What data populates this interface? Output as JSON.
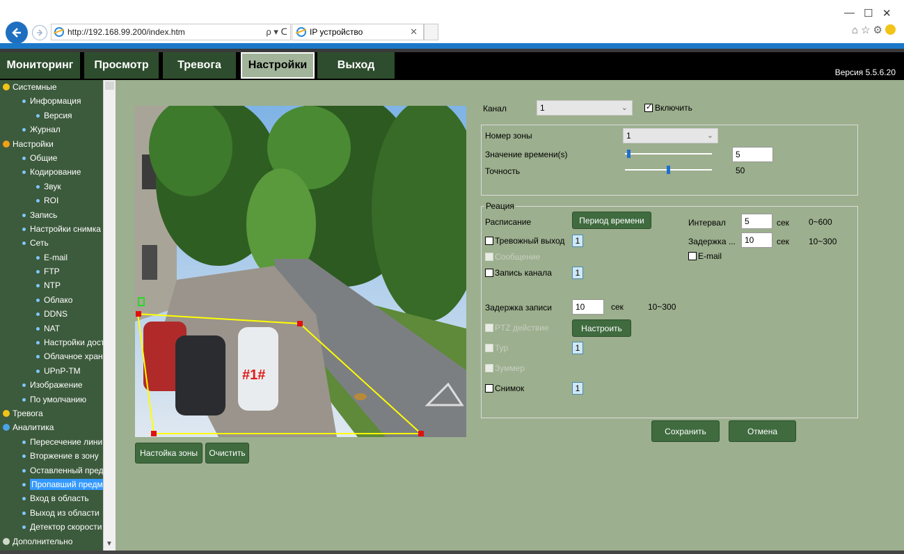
{
  "browser": {
    "url": "http://192.168.99.200/index.htm",
    "url_tools": "ρ ▾ ᑕ",
    "tab_title": "IP устройство"
  },
  "nav": {
    "tabs": [
      {
        "label": "Мониторинг"
      },
      {
        "label": "Просмотр"
      },
      {
        "label": "Тревога"
      },
      {
        "label": "Настройки"
      },
      {
        "label": "Выход"
      }
    ],
    "version": "Версия 5.5.6.20"
  },
  "sidebar": {
    "items": [
      {
        "label": "Системные",
        "level": 0,
        "icon": "info-icon"
      },
      {
        "label": "Информация",
        "level": 1
      },
      {
        "label": "Версия",
        "level": 2
      },
      {
        "label": "Журнал",
        "level": 1
      },
      {
        "label": "Настройки",
        "level": 0,
        "icon": "gear-icon"
      },
      {
        "label": "Общие",
        "level": 1
      },
      {
        "label": "Кодирование",
        "level": 1
      },
      {
        "label": "Звук",
        "level": 2
      },
      {
        "label": "ROI",
        "level": 2
      },
      {
        "label": "Запись",
        "level": 1
      },
      {
        "label": "Настройки снимка",
        "level": 1
      },
      {
        "label": "Сеть",
        "level": 1
      },
      {
        "label": "E-mail",
        "level": 2
      },
      {
        "label": "FTP",
        "level": 2
      },
      {
        "label": "NTP",
        "level": 2
      },
      {
        "label": "Облако",
        "level": 2
      },
      {
        "label": "DDNS",
        "level": 2
      },
      {
        "label": "NAT",
        "level": 2
      },
      {
        "label": "Настройки доступа",
        "level": 2
      },
      {
        "label": "Облачное хранилище",
        "level": 2
      },
      {
        "label": "UPnP-TM",
        "level": 2
      },
      {
        "label": "Изображение",
        "level": 1
      },
      {
        "label": "По умолчанию",
        "level": 1
      },
      {
        "label": "Тревога",
        "level": 0,
        "icon": "alarm-icon"
      },
      {
        "label": "Аналитика",
        "level": 0,
        "icon": "analytics-icon"
      },
      {
        "label": "Пересечение линии",
        "level": 1
      },
      {
        "label": "Вторжение в зону",
        "level": 1
      },
      {
        "label": "Оставленный предмет",
        "level": 1
      },
      {
        "label": "Пропавший предмет",
        "level": 1,
        "selected": true
      },
      {
        "label": "Вход в область",
        "level": 1
      },
      {
        "label": "Выход из области",
        "level": 1
      },
      {
        "label": "Детектор скорости",
        "level": 1
      },
      {
        "label": "Дополнительно",
        "level": 0,
        "icon": "tools-icon"
      }
    ]
  },
  "video": {
    "zone_label": "#1#",
    "zone_polygon": [
      [
        2,
        299
      ],
      [
        237,
        313
      ],
      [
        411,
        467
      ],
      [
        27,
        471
      ]
    ]
  },
  "zone_buttons": {
    "setup": "Настойка зоны",
    "clear": "Очистить"
  },
  "channel": {
    "label": "Канал",
    "value": "1",
    "enable_label": "Включить",
    "enabled": true
  },
  "zone_panel": {
    "zone_number_label": "Номер зоны",
    "zone_number_value": "1",
    "time_label": "Значение времени(s)",
    "time_value": "5",
    "time_fraction": 0.02,
    "accuracy_label": "Точность",
    "accuracy_value": "50",
    "accuracy_fraction": 0.48
  },
  "reaction": {
    "legend": "Реация",
    "schedule_label": "Расписание",
    "schedule_button": "Период времени",
    "interval_label": "Интервал",
    "interval_value": "5",
    "interval_unit": "сек",
    "interval_range": "0~600",
    "alarm_out_label": "Тревожный выход",
    "alarm_out_badge": "1",
    "delay_label": "Задержка ...",
    "delay_value": "10",
    "delay_unit": "сек",
    "delay_range": "10~300",
    "message_label": "Сообщение",
    "email_label": "E-mail",
    "record_channel_label": "Запись канала",
    "record_channel_badge": "1",
    "record_delay_label": "Задержка записи",
    "record_delay_value": "10",
    "record_delay_unit": "сек",
    "record_delay_range": "10~300",
    "ptz_label": "PTZ действие",
    "ptz_button": "Настроить",
    "tour_label": "Тур",
    "tour_badge": "1",
    "buzzer_label": "Зуммер",
    "snapshot_label": "Снимок",
    "snapshot_badge": "1"
  },
  "actions": {
    "save": "Сохранить",
    "cancel": "Отмена"
  },
  "colors": {
    "main_bg": "#9caf8e",
    "sidebar_bg": "#3c5a3c",
    "button_green": "#3f6b3f",
    "selected_blue": "#3399ff",
    "zone_line": "#ffff00",
    "zone_vertex": "#e01010"
  }
}
